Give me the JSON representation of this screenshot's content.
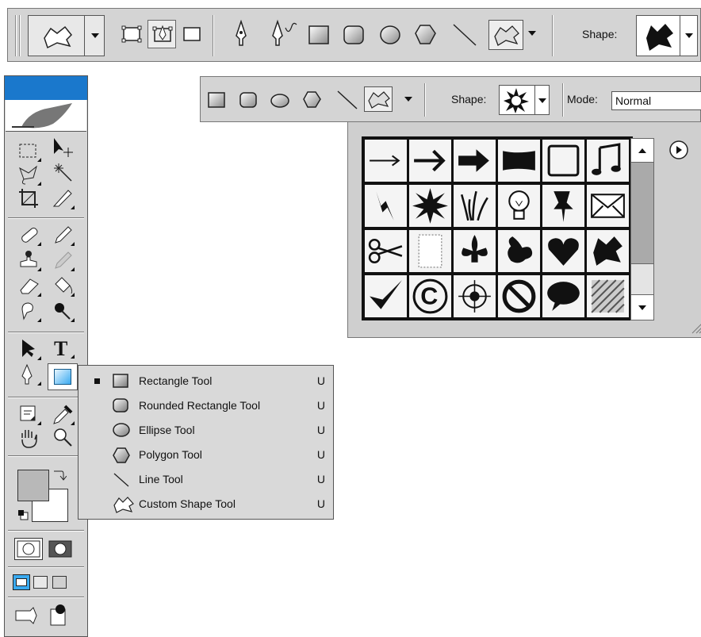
{
  "options_bar_top": {
    "shape_label": "Shape:",
    "icons": [
      "shape-layers-icon",
      "paths-icon",
      "fill-pixels-icon",
      "pen-icon",
      "freeform-pen-icon",
      "rectangle-icon",
      "rounded-rectangle-icon",
      "ellipse-icon",
      "polygon-icon",
      "line-icon",
      "custom-shape-icon",
      "blob-shape-icon"
    ]
  },
  "options_bar_second": {
    "shape_label": "Shape:",
    "mode_label": "Mode:",
    "mode_value": "Normal"
  },
  "shape_picker": {
    "shapes": [
      "arrow-thin",
      "arrow-medium",
      "arrow-bold",
      "banner",
      "frame",
      "music-note",
      "lightning",
      "starburst",
      "grass",
      "lightbulb",
      "pushpin",
      "envelope",
      "scissors",
      "stamp-frame",
      "fleur-de-lis",
      "ornament",
      "heart",
      "blob",
      "checkmark",
      "copyright",
      "target",
      "no-symbol",
      "speech-bubble",
      "hatched-square"
    ],
    "selected_index": 7
  },
  "tool_menu": {
    "items": [
      {
        "label": "Rectangle Tool",
        "key": "U",
        "icon": "rectangle-icon",
        "checked": true
      },
      {
        "label": "Rounded  Rectangle Tool",
        "key": "U",
        "icon": "rounded-rectangle-icon",
        "checked": false
      },
      {
        "label": "Ellipse Tool",
        "key": "U",
        "icon": "ellipse-icon",
        "checked": false
      },
      {
        "label": "Polygon Tool",
        "key": "U",
        "icon": "polygon-icon",
        "checked": false
      },
      {
        "label": "Line Tool",
        "key": "U",
        "icon": "line-icon",
        "checked": false
      },
      {
        "label": "Custom Shape Tool",
        "key": "U",
        "icon": "custom-shape-icon",
        "checked": false
      }
    ]
  },
  "colors": {
    "toolbox_title": "#1a78cc",
    "active_tool": "#3aaaf0",
    "foreground": "#b8b8b8",
    "background": "#ffffff"
  }
}
